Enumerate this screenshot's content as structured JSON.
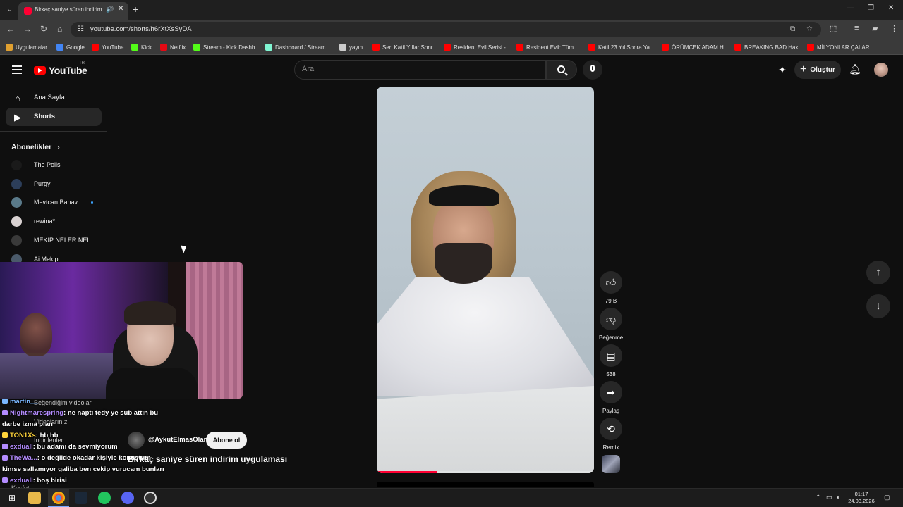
{
  "browser": {
    "tab": {
      "title": "Birkaç saniye süren indirim"
    },
    "url": "youtube.com/shorts/h6rXtXsSyDA",
    "bookmarks": [
      {
        "label": "Uygulamalar",
        "icon": "apps-grid-icon",
        "color": "#e0a030"
      },
      {
        "label": "Google",
        "icon": "google-icon",
        "color": "#4285f4"
      },
      {
        "label": "YouTube",
        "icon": "youtube-icon",
        "color": "#ff0000"
      },
      {
        "label": "Kick",
        "icon": "kick-icon",
        "color": "#53fc18"
      },
      {
        "label": "Netflix",
        "icon": "netflix-icon",
        "color": "#e50914"
      },
      {
        "label": "Stream - Kick Dashb...",
        "icon": "kick-icon",
        "color": "#53fc18"
      },
      {
        "label": "Dashboard / Stream...",
        "icon": "streamlabs-icon",
        "color": "#80f5d2"
      },
      {
        "label": "yayın",
        "icon": "folder-icon",
        "color": "#cccccc"
      },
      {
        "label": "Seri Katil Yıllar Sonr...",
        "icon": "youtube-icon",
        "color": "#ff0000"
      },
      {
        "label": "Resident Evil Serisi -...",
        "icon": "youtube-icon",
        "color": "#ff0000"
      },
      {
        "label": "Resident Evil: Tüm...",
        "icon": "youtube-icon",
        "color": "#ff0000"
      },
      {
        "label": "Katil 23 Yıl Sonra Ya...",
        "icon": "youtube-icon",
        "color": "#ff0000"
      },
      {
        "label": "ÖRÜMCEK ADAM H...",
        "icon": "youtube-icon",
        "color": "#ff0000"
      },
      {
        "label": "BREAKING BAD Hak...",
        "icon": "youtube-icon",
        "color": "#ff0000"
      },
      {
        "label": "MİLYONLAR ÇALAR...",
        "icon": "youtube-icon",
        "color": "#ff0000"
      }
    ]
  },
  "youtube": {
    "logo_text": "YouTube",
    "logo_sup": "TR",
    "search_placeholder": "Ara",
    "create_label": "Oluştur",
    "nav": [
      {
        "label": "Ana Sayfa",
        "icon": "home-icon"
      },
      {
        "label": "Shorts",
        "icon": "shorts-icon"
      }
    ],
    "subscriptions_header": "Abonelikler",
    "subscriptions": [
      {
        "name": "The Polis",
        "color": "#1a1a1a",
        "new": false
      },
      {
        "name": "Purgy",
        "color": "#2c3e5a",
        "new": false
      },
      {
        "name": "Mevtcan Bahav",
        "color": "#5a7a8a",
        "new": true
      },
      {
        "name": "rewina*",
        "color": "#d9d2d2",
        "new": false
      },
      {
        "name": "MEKİP NELER NEL...",
        "color": "#3a3a3a",
        "new": false
      },
      {
        "name": "Ai Mekip",
        "color": "#4a5a6a",
        "new": false
      }
    ],
    "sidebar_hidden": [
      "Beğendiğim videolar",
      "Videolarınız",
      "İndirilenler",
      "Kesfet"
    ],
    "short": {
      "channel": "@AykutElmasOlan",
      "subscribe_label": "Abone ol",
      "title": "Birkaç saniye süren indirim uygulaması",
      "progress": 0.28
    },
    "actions": [
      {
        "icon": "like-icon",
        "label": "79 B"
      },
      {
        "icon": "dislike-icon",
        "label": "Beğenme"
      },
      {
        "icon": "comment-icon",
        "label": "538"
      },
      {
        "icon": "share-icon",
        "label": "Paylaş"
      },
      {
        "icon": "remix-icon",
        "label": "Remix"
      }
    ]
  },
  "chat": [
    {
      "user": "martin__",
      "text": "",
      "color": "#7ab7ff"
    },
    {
      "user": "Nightmarespring",
      "text": ": ne naptı tedy ye sub attın bu",
      "color": "#b48cff"
    },
    {
      "user": "",
      "text": "darbe izma plan",
      "color": "#ffffff"
    },
    {
      "user": "TON1Xs",
      "text": ": hb hb",
      "color": "#ffd43b"
    },
    {
      "user": "exduall",
      "text": ": bu adamı da sevmiyorum",
      "color": "#b48cff"
    },
    {
      "user": "TheWa...",
      "text": ": o değilde okadar kişiyle konuştum",
      "color": "#b48cff"
    },
    {
      "user": "",
      "text": "kimse sallamıyor galiba ben cekip vurucam bunları",
      "color": "#ffffff"
    },
    {
      "user": "exduall",
      "text": ": boş birisi",
      "color": "#b48cff"
    }
  ],
  "taskbar": {
    "time": "01:17",
    "date": "24.03.2026"
  }
}
